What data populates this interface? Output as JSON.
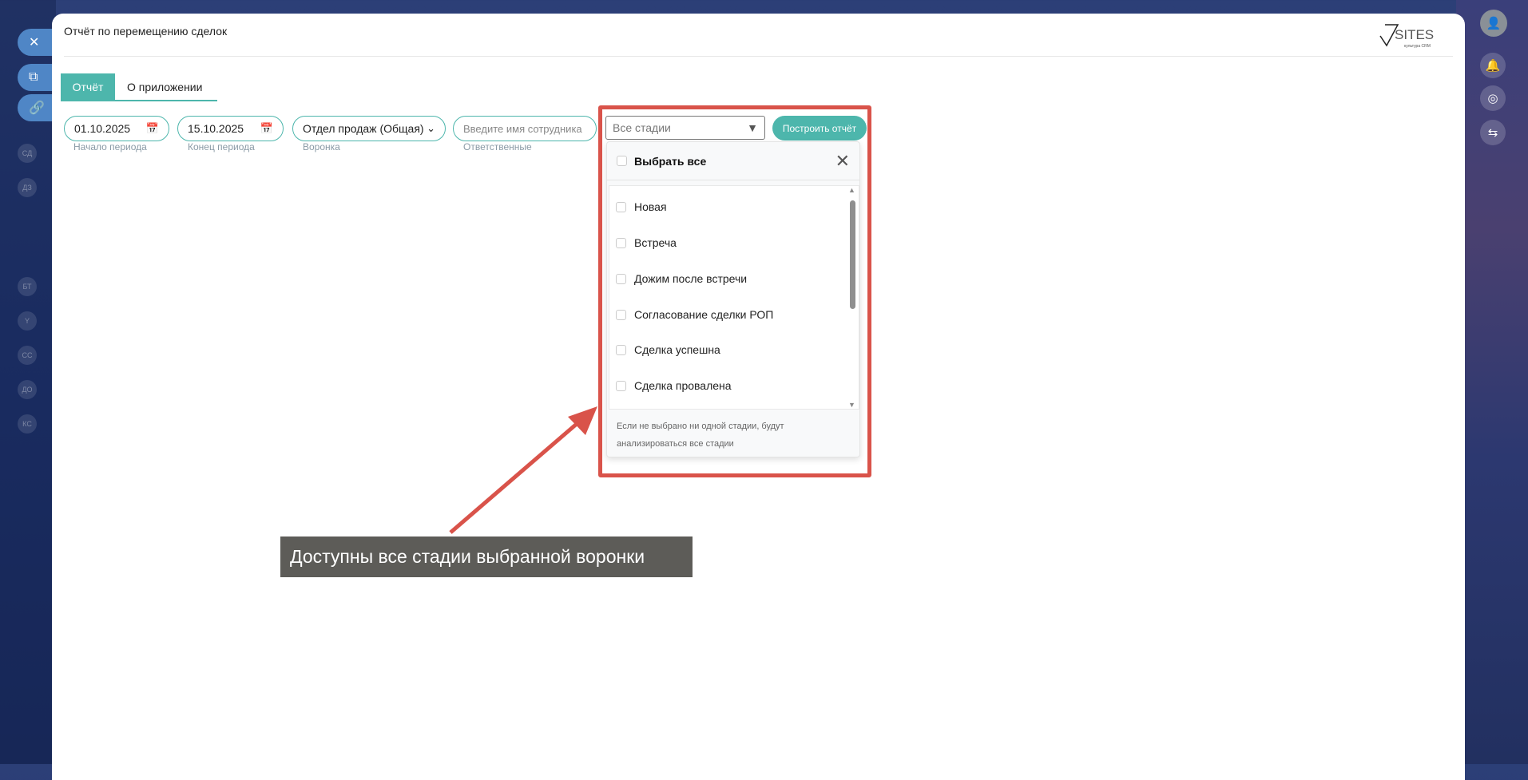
{
  "modal": {
    "title": "Отчёт по перемещению сделок",
    "logo_text": "SITES",
    "logo_sub": "культура CRM"
  },
  "tabs": [
    {
      "label": "Отчёт",
      "active": true
    },
    {
      "label": "О приложении",
      "active": false
    }
  ],
  "filters": {
    "start_date": {
      "value": "01.10.2025",
      "label": "Начало периода"
    },
    "end_date": {
      "value": "15.10.2025",
      "label": "Конец периода"
    },
    "funnel": {
      "value": "Отдел продаж (Общая)",
      "label": "Воронка"
    },
    "employee": {
      "placeholder": "Введите имя сотрудника",
      "label": "Ответственные"
    },
    "stages": {
      "value": "Все стадии"
    },
    "build_label": "Построить отчёт"
  },
  "dropdown": {
    "select_all": "Выбрать все",
    "items": [
      "Новая",
      "Встреча",
      "Дожим после встречи",
      "Согласование сделки РОП",
      "Сделка успешна",
      "Сделка провалена"
    ],
    "footer_line1": "Если не выбрано ни одной стадии, будут",
    "footer_line2": "анализироваться все стадии"
  },
  "annotation": {
    "caption": "Доступны все стадии выбранной воронки",
    "color": "#d9534a"
  },
  "sidebar_ghost": [
    "СД",
    "ДЗ",
    "",
    "",
    "БТ",
    "Y",
    "СС",
    "ДО",
    "КС"
  ]
}
